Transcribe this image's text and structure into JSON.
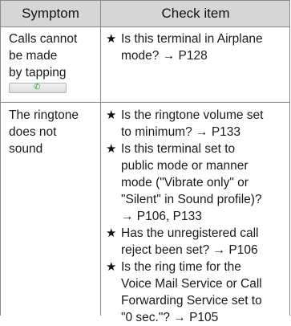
{
  "header": {
    "symptom": "Symptom",
    "check_item": "Check item"
  },
  "rows": [
    {
      "symptom_lines": [
        "Calls cannot",
        "be made",
        "by tapping"
      ],
      "key_icon": "phone-call-key-icon",
      "checks": [
        {
          "bullet": "★",
          "lines": [
            "Is this terminal in Airplane",
            "mode? → P128"
          ]
        }
      ]
    },
    {
      "symptom_lines": [
        "The ringtone",
        "does not",
        "sound"
      ],
      "checks": [
        {
          "bullet": "★",
          "lines": [
            "Is the ringtone volume set",
            "to minimum? → P133"
          ]
        },
        {
          "bullet": "★",
          "lines": [
            "Is this terminal set to",
            "public mode or manner",
            "mode (\"Vibrate only\" or",
            "\"Silent\" in Sound profile)?",
            "→ P106, P133"
          ]
        },
        {
          "bullet": "★",
          "lines": [
            "Has the unregistered call",
            "reject been set? → P106"
          ]
        },
        {
          "bullet": "★",
          "lines": [
            "Is the ring time for the",
            "Voice Mail Service or Call",
            "Forwarding Service set to",
            "\"0 sec.\"? → P105"
          ]
        }
      ]
    }
  ]
}
